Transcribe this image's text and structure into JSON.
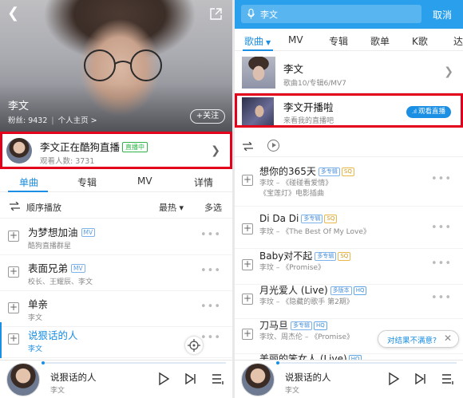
{
  "left": {
    "artist": "李文",
    "fans_label": "粉丝: 9432",
    "homepage": "个人主页 >",
    "follow": "+关注",
    "live": {
      "title": "李文正在酷狗直播",
      "badge": "直播中",
      "viewers": "观看人数: 3731"
    },
    "tabs": [
      "单曲",
      "专辑",
      "MV",
      "详情"
    ],
    "sort": {
      "order": "顺序播放",
      "hot": "最热 ▾",
      "multi": "多选"
    },
    "songs": [
      {
        "name": "为梦想加油",
        "tag": "MV",
        "sub": "酷狗直播群星"
      },
      {
        "name": "表面兄弟",
        "tag": "MV",
        "sub": "校长、王耀辰、李文"
      },
      {
        "name": "单亲",
        "tag": "",
        "sub": "李文"
      },
      {
        "name": "说狠话的人",
        "tag": "",
        "sub": "李文",
        "playing": true
      }
    ],
    "player": {
      "song": "说狠话的人",
      "artist": "李文"
    }
  },
  "right": {
    "search": {
      "value": "李文",
      "cancel": "取消"
    },
    "tabs": [
      "歌曲",
      "MV",
      "专辑",
      "歌单",
      "K歌",
      "达"
    ],
    "artist_card": {
      "name": "李文",
      "stats": "歌曲10/专辑6/MV7"
    },
    "live_card": {
      "title": "李文开播啦",
      "sub": "来看我的直播吧",
      "button": "观看直播"
    },
    "songs": [
      {
        "name": "想你的365天",
        "ver": "多专辑",
        "sq": "SQ",
        "hq": "",
        "sub": "李玟 – 《碰碰看爱情》",
        "sub2": "《宝莲灯》电影插曲"
      },
      {
        "name": "Di Da Di",
        "ver": "多专辑",
        "sq": "SQ",
        "hq": "",
        "sub": "李玟 – 《The Best Of My Love》",
        "sub2": ""
      },
      {
        "name": "Baby对不起",
        "ver": "多专辑",
        "sq": "SQ",
        "hq": "",
        "sub": "李玟 – 《Promise》",
        "sub2": ""
      },
      {
        "name": "月光爱人 (Live)",
        "ver": "多版本",
        "sq": "",
        "hq": "HQ",
        "sub": "李玟 – 《隐藏的歌手 第2期》",
        "sub2": ""
      },
      {
        "name": "刀马旦",
        "ver": "多专辑",
        "sq": "",
        "hq": "HQ",
        "sub": "李玟、周杰伦 – 《Promise》",
        "sub2": ""
      },
      {
        "name": "美丽的笨女人 (Live)",
        "ver": "",
        "sq": "",
        "hq": "HQ",
        "sub": "",
        "sub2": ""
      }
    ],
    "feedback": "对结果不满意?",
    "player": {
      "song": "说狠话的人",
      "artist": "李文"
    }
  }
}
